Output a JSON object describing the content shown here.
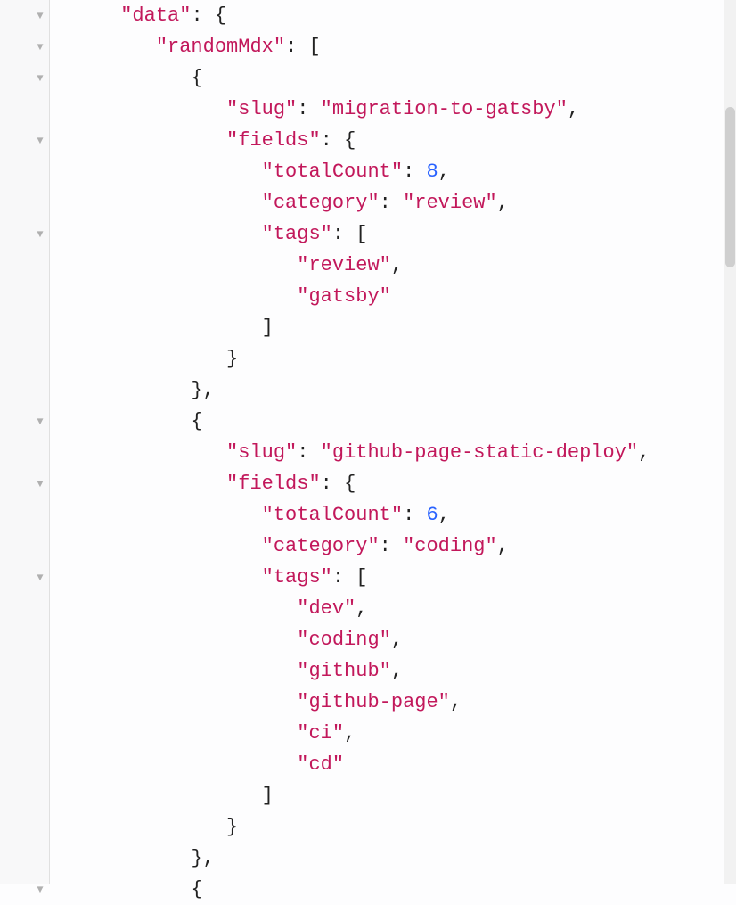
{
  "indent": "   ",
  "lines": [
    {
      "depth": 2,
      "toggle": true,
      "tokens": [
        [
          "key",
          "\"data\""
        ],
        [
          "punc",
          ": {"
        ]
      ]
    },
    {
      "depth": 3,
      "toggle": true,
      "tokens": [
        [
          "key",
          "\"randomMdx\""
        ],
        [
          "punc",
          ": ["
        ]
      ]
    },
    {
      "depth": 4,
      "toggle": true,
      "tokens": [
        [
          "punc",
          "{"
        ]
      ]
    },
    {
      "depth": 5,
      "toggle": false,
      "tokens": [
        [
          "key",
          "\"slug\""
        ],
        [
          "punc",
          ": "
        ],
        [
          "str",
          "\"migration-to-gatsby\""
        ],
        [
          "punc",
          ","
        ]
      ]
    },
    {
      "depth": 5,
      "toggle": true,
      "tokens": [
        [
          "key",
          "\"fields\""
        ],
        [
          "punc",
          ": {"
        ]
      ]
    },
    {
      "depth": 6,
      "toggle": false,
      "tokens": [
        [
          "key",
          "\"totalCount\""
        ],
        [
          "punc",
          ": "
        ],
        [
          "num",
          "8"
        ],
        [
          "punc",
          ","
        ]
      ]
    },
    {
      "depth": 6,
      "toggle": false,
      "tokens": [
        [
          "key",
          "\"category\""
        ],
        [
          "punc",
          ": "
        ],
        [
          "str",
          "\"review\""
        ],
        [
          "punc",
          ","
        ]
      ]
    },
    {
      "depth": 6,
      "toggle": true,
      "tokens": [
        [
          "key",
          "\"tags\""
        ],
        [
          "punc",
          ": ["
        ]
      ]
    },
    {
      "depth": 7,
      "toggle": false,
      "tokens": [
        [
          "str",
          "\"review\""
        ],
        [
          "punc",
          ","
        ]
      ]
    },
    {
      "depth": 7,
      "toggle": false,
      "tokens": [
        [
          "str",
          "\"gatsby\""
        ]
      ]
    },
    {
      "depth": 6,
      "toggle": false,
      "tokens": [
        [
          "punc",
          "]"
        ]
      ]
    },
    {
      "depth": 5,
      "toggle": false,
      "tokens": [
        [
          "punc",
          "}"
        ]
      ]
    },
    {
      "depth": 4,
      "toggle": false,
      "tokens": [
        [
          "punc",
          "},"
        ]
      ]
    },
    {
      "depth": 4,
      "toggle": true,
      "tokens": [
        [
          "punc",
          "{"
        ]
      ]
    },
    {
      "depth": 5,
      "toggle": false,
      "tokens": [
        [
          "key",
          "\"slug\""
        ],
        [
          "punc",
          ": "
        ],
        [
          "str",
          "\"github-page-static-deploy\""
        ],
        [
          "punc",
          ","
        ]
      ]
    },
    {
      "depth": 5,
      "toggle": true,
      "tokens": [
        [
          "key",
          "\"fields\""
        ],
        [
          "punc",
          ": {"
        ]
      ]
    },
    {
      "depth": 6,
      "toggle": false,
      "tokens": [
        [
          "key",
          "\"totalCount\""
        ],
        [
          "punc",
          ": "
        ],
        [
          "num",
          "6"
        ],
        [
          "punc",
          ","
        ]
      ]
    },
    {
      "depth": 6,
      "toggle": false,
      "tokens": [
        [
          "key",
          "\"category\""
        ],
        [
          "punc",
          ": "
        ],
        [
          "str",
          "\"coding\""
        ],
        [
          "punc",
          ","
        ]
      ]
    },
    {
      "depth": 6,
      "toggle": true,
      "tokens": [
        [
          "key",
          "\"tags\""
        ],
        [
          "punc",
          ": ["
        ]
      ]
    },
    {
      "depth": 7,
      "toggle": false,
      "tokens": [
        [
          "str",
          "\"dev\""
        ],
        [
          "punc",
          ","
        ]
      ]
    },
    {
      "depth": 7,
      "toggle": false,
      "tokens": [
        [
          "str",
          "\"coding\""
        ],
        [
          "punc",
          ","
        ]
      ]
    },
    {
      "depth": 7,
      "toggle": false,
      "tokens": [
        [
          "str",
          "\"github\""
        ],
        [
          "punc",
          ","
        ]
      ]
    },
    {
      "depth": 7,
      "toggle": false,
      "tokens": [
        [
          "str",
          "\"github-page\""
        ],
        [
          "punc",
          ","
        ]
      ]
    },
    {
      "depth": 7,
      "toggle": false,
      "tokens": [
        [
          "str",
          "\"ci\""
        ],
        [
          "punc",
          ","
        ]
      ]
    },
    {
      "depth": 7,
      "toggle": false,
      "tokens": [
        [
          "str",
          "\"cd\""
        ]
      ]
    },
    {
      "depth": 6,
      "toggle": false,
      "tokens": [
        [
          "punc",
          "]"
        ]
      ]
    },
    {
      "depth": 5,
      "toggle": false,
      "tokens": [
        [
          "punc",
          "}"
        ]
      ]
    },
    {
      "depth": 4,
      "toggle": false,
      "tokens": [
        [
          "punc",
          "},"
        ]
      ]
    },
    {
      "depth": 4,
      "toggle": true,
      "tokens": [
        [
          "punc",
          "{"
        ]
      ]
    }
  ]
}
